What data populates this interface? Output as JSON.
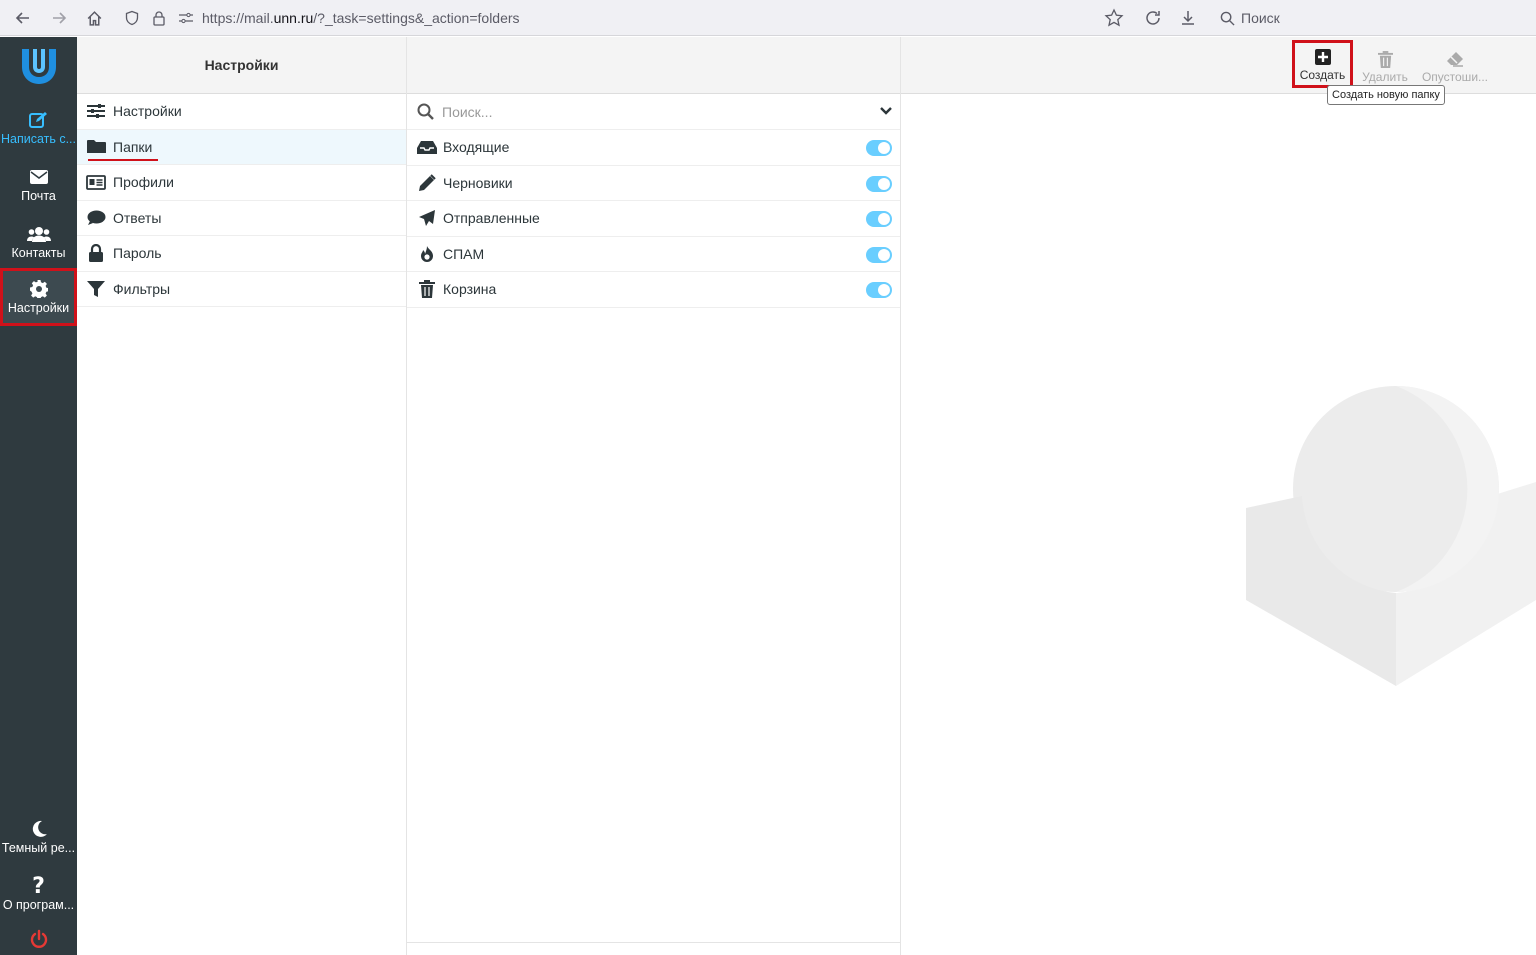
{
  "browser": {
    "url_host": "https://mail.",
    "url_domain": "unn.ru",
    "url_path": "/?_task=settings&_action=folders",
    "search_placeholder": "Поиск"
  },
  "appnav": {
    "compose": "Написать с...",
    "mail": "Почта",
    "contacts": "Контакты",
    "settings": "Настройки",
    "dark_mode": "Темный ре...",
    "about": "О програм..."
  },
  "settings_panel": {
    "title": "Настройки",
    "items": [
      {
        "label": "Настройки",
        "icon": "sliders-icon"
      },
      {
        "label": "Папки",
        "icon": "folder-icon"
      },
      {
        "label": "Профили",
        "icon": "id-card-icon"
      },
      {
        "label": "Ответы",
        "icon": "comment-icon"
      },
      {
        "label": "Пароль",
        "icon": "lock-icon"
      },
      {
        "label": "Фильтры",
        "icon": "filter-icon"
      }
    ]
  },
  "folders_panel": {
    "search_placeholder": "Поиск...",
    "folders": [
      {
        "label": "Входящие",
        "icon": "inbox-icon",
        "subscribed": true
      },
      {
        "label": "Черновики",
        "icon": "pencil-icon",
        "subscribed": true
      },
      {
        "label": "Отправленные",
        "icon": "paper-plane-icon",
        "subscribed": true
      },
      {
        "label": "СПАМ",
        "icon": "fire-icon",
        "subscribed": true
      },
      {
        "label": "Корзина",
        "icon": "trash-icon",
        "subscribed": true
      }
    ]
  },
  "toolbar": {
    "create": "Создать",
    "delete": "Удалить",
    "purge": "Опустоши...",
    "create_tooltip": "Создать новую папку"
  },
  "colors": {
    "accent": "#37beff",
    "nav_bg": "#2f3a3f",
    "highlight": "#d0111a"
  }
}
